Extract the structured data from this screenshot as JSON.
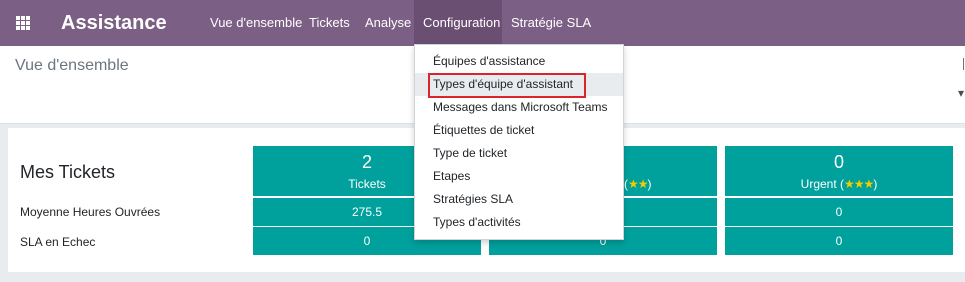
{
  "navbar": {
    "app_title": "Assistance",
    "menu": [
      {
        "label": "Vue d'ensemble"
      },
      {
        "label": "Tickets"
      },
      {
        "label": "Analyse"
      },
      {
        "label": "Configuration"
      },
      {
        "label": "Stratégie SLA"
      }
    ]
  },
  "control_panel": {
    "breadcrumb": "Vue d'ensemble"
  },
  "dashboard": {
    "section_title": "Mes Tickets",
    "row_labels": [
      "Moyenne Heures Ouvrées",
      "SLA en Echec"
    ],
    "cards": [
      {
        "count": "2",
        "label": "Tickets",
        "stars": "",
        "avg_hours": "275.5",
        "sla_failed": "0"
      },
      {
        "count": "",
        "label": "(",
        "stars": "★★",
        "label_suffix": ")",
        "avg_hours": "",
        "sla_failed": "0"
      },
      {
        "count": "0",
        "label": "Urgent (",
        "stars": "★★★",
        "label_suffix": ")",
        "avg_hours": "0",
        "sla_failed": "0"
      }
    ]
  },
  "configuration_menu": {
    "items": [
      {
        "label": "Équipes d'assistance"
      },
      {
        "label": "Types d'équipe d'assistant"
      },
      {
        "label": "Messages dans Microsoft Teams"
      },
      {
        "label": "Étiquettes de ticket"
      },
      {
        "label": "Type de ticket"
      },
      {
        "label": "Etapes"
      },
      {
        "label": "Stratégies SLA"
      },
      {
        "label": "Types d'activités"
      }
    ],
    "highlighted_index": 1
  },
  "colors": {
    "navbar": "#7c5f84",
    "card": "#00a09d",
    "star": "#f3cc00",
    "highlight_border": "#d9262b"
  }
}
